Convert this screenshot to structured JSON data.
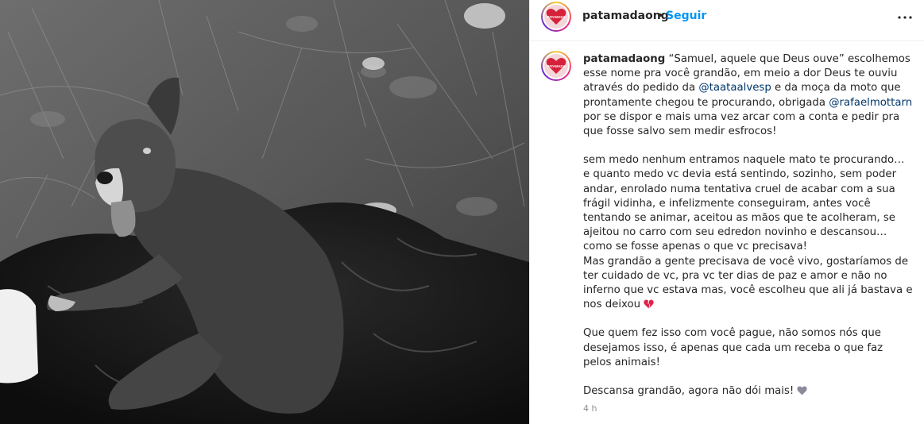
{
  "post": {
    "username": "patamadaong",
    "separator": "•",
    "follow_label": "Seguir",
    "logo_text": "PATAMADA",
    "more_icon": "more-horizontal-icon"
  },
  "caption": {
    "username": "patamadaong",
    "p1_a": " “Samuel, aquele que Deus ouve” escolhemos esse nome pra você grandão, em meio a dor Deus te ouviu através do pedido da ",
    "mention_1": "@taataalvesp",
    "p1_b": " e da moça da moto que prontamente chegou te procurando, obrigada ",
    "mention_2": "@rafaelmottarn",
    "p1_c": " por se dispor e mais uma vez arcar com a conta e pedir pra que fosse salvo sem medir esfrocos!",
    "p2": "sem medo nenhum entramos naquele mato te procurando… e quanto medo vc devia está sentindo, sozinho, sem poder andar, enrolado numa tentativa cruel de acabar com a sua frágil vidinha, e infelizmente conseguiram, antes você tentando se animar, aceitou as mãos que te acolheram, se ajeitou no carro com seu edredon novinho e descansou… como se fosse apenas o que vc precisava!",
    "p3": "Mas grandão a gente precisava de você vivo, gostaríamos de ter cuidado de vc, pra vc ter dias de paz e amor e não no inferno que vc estava mas, você escolheu que ali já bastava e nos deixou ",
    "p4": "Que quem fez isso com você pague, não somos nós que desejamos isso, é apenas que cada um receba o que faz pelos animais!",
    "p5": "Descansa grandão, agora não dói mais! ",
    "emoji_1": "broken-heart-emoji",
    "emoji_2": "grey-heart-emoji"
  },
  "meta": {
    "time": "4 h"
  },
  "colors": {
    "link": "#0095f6",
    "mention": "#00376b",
    "logo_heart": "#d6213a"
  }
}
